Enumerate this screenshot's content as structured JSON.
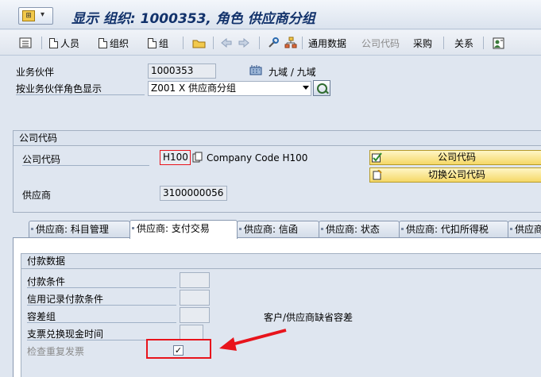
{
  "header": {
    "title": "显示 组织: 1000353, 角色 供应商分组"
  },
  "toolbar": {
    "items": [
      {
        "label": "人员"
      },
      {
        "label": "组织"
      },
      {
        "label": "组"
      },
      {
        "label": "通用数据"
      },
      {
        "label": "公司代码"
      },
      {
        "label": "采购"
      },
      {
        "label": "关系"
      }
    ]
  },
  "partner": {
    "bp_label": "业务伙伴",
    "bp_value": "1000353",
    "bp_name": "九域 / 九域",
    "role_label": "按业务伙伴角色显示",
    "role_value": "Z001  X 供应商分组"
  },
  "company": {
    "group_title": "公司代码",
    "code_label": "公司代码",
    "code_value": "H100",
    "code_desc": "Company Code H100",
    "vendor_label": "供应商",
    "vendor_value": "3100000056",
    "btn_company": "公司代码",
    "btn_switch": "切换公司代码"
  },
  "tabs": [
    {
      "label": "供应商: 科目管理"
    },
    {
      "label": "供应商: 支付交易"
    },
    {
      "label": "供应商: 信函"
    },
    {
      "label": "供应商: 状态"
    },
    {
      "label": "供应商: 代扣所得税"
    },
    {
      "label": "供应商:"
    }
  ],
  "payment": {
    "group_title": "付款数据",
    "fields": [
      {
        "label": "付款条件"
      },
      {
        "label": "信用记录付款条件"
      },
      {
        "label": "容差组"
      },
      {
        "label": "支票兑换现金时间"
      },
      {
        "label": "检查重复发票"
      }
    ],
    "tolerance_note": "客户/供应商缺省容差",
    "duplicate_check": "✓"
  },
  "colors": {
    "annotation": "#e8141c",
    "button_yellow": "#f5d867"
  }
}
